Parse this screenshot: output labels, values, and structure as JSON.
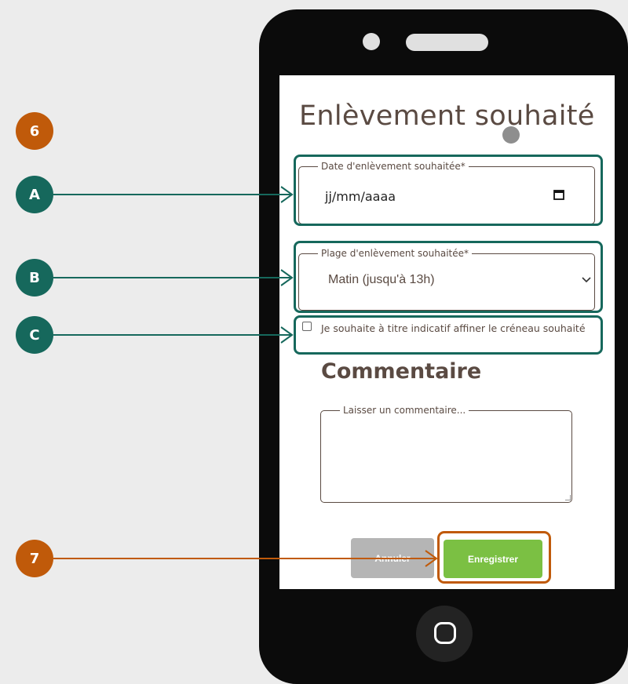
{
  "form": {
    "title": "Enlèvement souhaité",
    "date_field": {
      "legend": "Date d'enlèvement souhaitée*",
      "placeholder_value": "jj/mm/aaaa"
    },
    "slot_field": {
      "legend": "Plage d'enlèvement souhaitée*",
      "selected": "Matin (jusqu'à 13h)"
    },
    "refine_checkbox": {
      "label": "Je souhaite à titre indicatif affiner le créneau souhaité",
      "checked": false
    },
    "comment_section": {
      "title": "Commentaire",
      "legend": "Laisser un commentaire..."
    },
    "buttons": {
      "cancel": "Annuler",
      "save": "Enregistrer"
    }
  },
  "annotations": {
    "step_6": "6",
    "marker_a": "A",
    "marker_b": "B",
    "marker_c": "C",
    "step_7": "7"
  },
  "colors": {
    "teal": "#16685c",
    "orange": "#c05a0a",
    "save_green": "#7bc043",
    "cancel_gray": "#b5b5b5",
    "text_brown": "#5a4a42"
  },
  "icons": {
    "calendar": "calendar-icon",
    "chevron": "chevron-down-icon",
    "home": "home-button-icon"
  }
}
